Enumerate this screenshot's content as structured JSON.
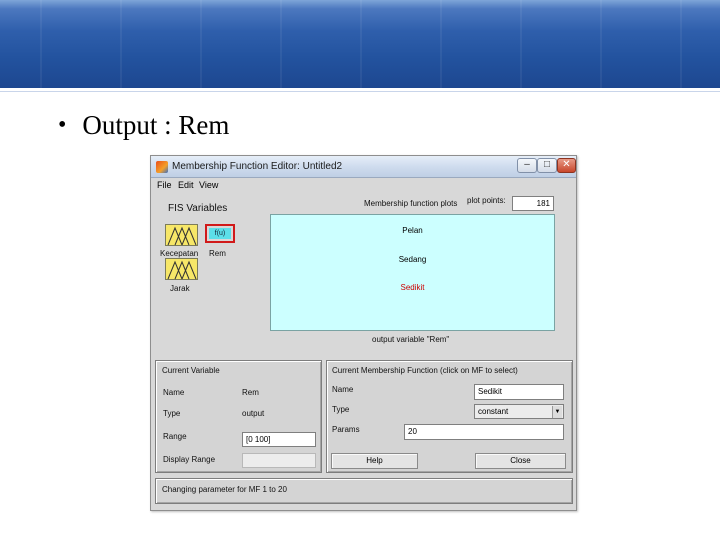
{
  "slide": {
    "bullet": "•",
    "text": "Output : Rem"
  },
  "window": {
    "title": "Membership Function Editor: Untitled2",
    "buttons": {
      "minimize": "–",
      "maximize": "□",
      "close": "✕"
    },
    "menu": [
      "File",
      "Edit",
      "View"
    ]
  },
  "fis": {
    "heading": "FIS Variables",
    "inputs": [
      "Kecepatan",
      "Jarak"
    ],
    "output_label": "Rem",
    "output_icon_text": "f(u)"
  },
  "plot": {
    "header": "Membership function plots",
    "points_label": "plot points:",
    "points_value": "181",
    "mfs": [
      {
        "name": "Pelan",
        "color": "#000000"
      },
      {
        "name": "Sedang",
        "color": "#000000"
      },
      {
        "name": "Sedikit",
        "color": "#cc0000"
      }
    ],
    "caption": "output variable \"Rem\""
  },
  "current_variable": {
    "title": "Current Variable",
    "name_label": "Name",
    "name_value": "Rem",
    "type_label": "Type",
    "type_value": "output",
    "range_label": "Range",
    "range_value": "[0 100]",
    "display_range_label": "Display Range"
  },
  "current_mf": {
    "title": "Current Membership Function (click on MF to select)",
    "name_label": "Name",
    "name_value": "Sedikit",
    "type_label": "Type",
    "type_value": "constant",
    "params_label": "Params",
    "params_value": "20"
  },
  "actions": {
    "help": "Help",
    "close": "Close"
  },
  "status": "Changing parameter for MF 1 to 20",
  "colors": {
    "plot_bg": "#ccffff",
    "selected_mf": "#cc0000",
    "highlight_border": "#d11a1a",
    "input_icon": "#f7e768",
    "output_icon": "#5cdfe9"
  }
}
